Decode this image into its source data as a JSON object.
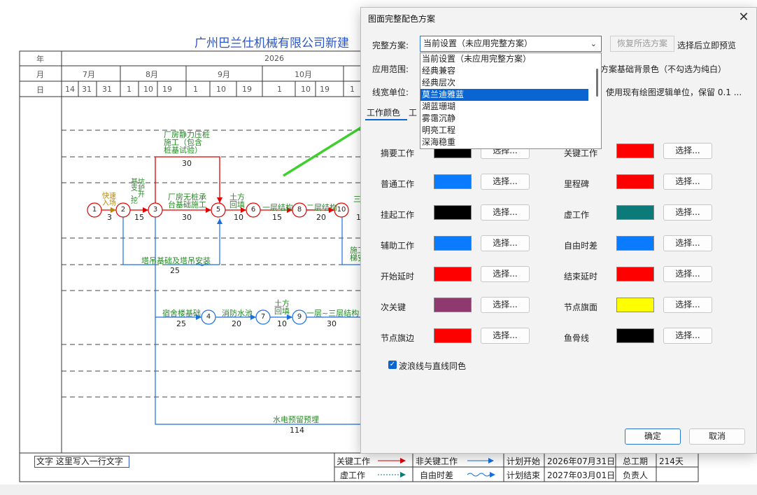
{
  "chart": {
    "title": "广州巴兰仕机械有限公司新建",
    "header": {
      "year_label": "年",
      "year": "2026",
      "month_label": "月",
      "months": [
        "7月",
        "8月",
        "9月",
        "10月"
      ],
      "day_label": "日",
      "days": [
        "14",
        "31",
        "31",
        "1",
        "10",
        "19",
        "1",
        "10",
        "19",
        "1",
        "10",
        "19",
        "1"
      ]
    },
    "nodes": [
      "1",
      "2",
      "3",
      "5",
      "6",
      "8",
      "10",
      "4",
      "7",
      "9"
    ],
    "tasks": {
      "quick_entry": "快速\n入场",
      "quick_entry_dur": "3",
      "pit": "基坑\n支护\n、开\n挖",
      "pit_dur": "15",
      "pile": "厂房静力压桩\n施工（包含\n桩基试验）",
      "pile_dur": "30",
      "found": "厂房无桩承\n台基础施工",
      "found_dur": "30",
      "earth": "土方\n回填",
      "earth_dur": "10",
      "floor1": "一层结构",
      "floor1_dur": "15",
      "floor2": "二层结构",
      "floor2_dur": "20",
      "crane": "塔吊基础及塔吊安装",
      "crane_dur": "25",
      "dorm": "宿舍楼基础",
      "dorm_dur": "25",
      "pool": "消防水池",
      "pool_dur": "20",
      "earth2": "土方\n回填",
      "earth2_dur": "10",
      "floors13": "一层~三层结构",
      "floors13_dur": "30",
      "water": "水电预留预埋",
      "water_dur": "114",
      "cut_a": "三",
      "cut_b": "施工\n梯安",
      "cut_dur": "1"
    },
    "text_box": "文字 这里写入一行文字",
    "legend": {
      "critical": "关键工作",
      "noncritical": "非关键工作",
      "plan_start": "计划开始",
      "plan_start_val": "2026年07月31日",
      "total_label": "总工期",
      "total_val": "214天",
      "virtual": "虚工作",
      "free_float": "自由时差",
      "plan_end": "计划结束",
      "plan_end_val": "2027年03月01日",
      "owner": "负责人"
    }
  },
  "dialog": {
    "title": "图面完整配色方案",
    "scheme_label": "完整方案:",
    "scheme_value": "当前设置（未应用完整方案）",
    "restore": "恢复所选方案",
    "preview_text": "选择后立即预览",
    "scope_label": "应用范围:",
    "scope_right": "方案基础背景色（不勾选为纯白）",
    "width_label": "线宽单位:",
    "width_right": "使用现有绘图逻辑单位，保留 0.1 ...",
    "dropdown": [
      "当前设置（未应用完整方案）",
      "经典兼容",
      "经典层次",
      "莫兰迪雅蓝",
      "湖蓝珊瑚",
      "雾霭沉静",
      "明亮工程",
      "深海稳重"
    ],
    "dropdown_selected_index": 3,
    "tabs": [
      "工作颜色",
      "工"
    ],
    "choose": "选择...",
    "colors_left": [
      {
        "label": "摘要工作",
        "color": "#000000"
      },
      {
        "label": "普通工作",
        "color": "#0a7bff"
      },
      {
        "label": "挂起工作",
        "color": "#000000"
      },
      {
        "label": "辅助工作",
        "color": "#0a7bff"
      },
      {
        "label": "开始延时",
        "color": "#ff0000"
      },
      {
        "label": "次关键",
        "color": "#8f3a6e"
      },
      {
        "label": "节点旗边",
        "color": "#ff0000"
      }
    ],
    "colors_right": [
      {
        "label": "关键工作",
        "color": "#ff0000"
      },
      {
        "label": "里程碑",
        "color": "#ff0000"
      },
      {
        "label": "虚工作",
        "color": "#0d7a7a"
      },
      {
        "label": "自由时差",
        "color": "#0a7bff"
      },
      {
        "label": "结束延时",
        "color": "#ff0000"
      },
      {
        "label": "节点旗面",
        "color": "#ffff00"
      },
      {
        "label": "鱼骨线",
        "color": "#000000"
      }
    ],
    "wave_checkbox": "波浪线与直线同色",
    "ok": "确定",
    "cancel": "取消"
  }
}
